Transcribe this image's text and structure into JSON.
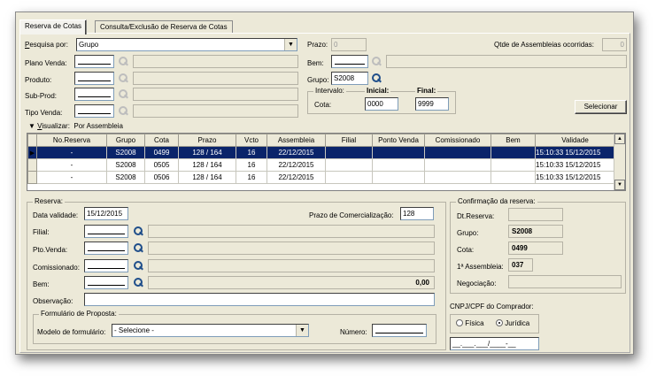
{
  "tabs": [
    "Reserva de Cotas",
    "Consulta/Exclusão de Reserva de Cotas"
  ],
  "pesquisa": {
    "label": "Pesquisa por:",
    "label_key": "P",
    "value": "Grupo"
  },
  "filters": [
    {
      "label": "Plano Venda:"
    },
    {
      "label": "Produto:"
    },
    {
      "label": "Sub-Prod:"
    },
    {
      "label": "Tipo Venda:"
    }
  ],
  "right": {
    "prazo_label": "Prazo:",
    "prazo_value": "0",
    "bem_label": "Bem:",
    "grupo_label": "Grupo:",
    "grupo_value": "S2008",
    "qtde_label": "Qtde de Assembleias ocorridas:",
    "qtde_value": "0",
    "intervalo_label": "Intervalo:",
    "inicial_label": "Inicial:",
    "final_label": "Final:",
    "cota_label": "Cota:",
    "inicial_value": "0000",
    "final_value": "9999",
    "selecionar_label": "Selecionar"
  },
  "visualizar": {
    "label": "Visualizar:",
    "label_key": "V",
    "value": "Por Assembleia"
  },
  "grid": {
    "columns": [
      "No.Reserva",
      "Grupo",
      "Cota",
      "Prazo",
      "Vcto",
      "Assembleia",
      "Filial",
      "Ponto Venda",
      "Comissionado",
      "Bem",
      "Validade"
    ],
    "rows": [
      [
        "-",
        "S2008",
        "0499",
        "128 / 164",
        "16",
        "22/12/2015",
        "",
        "",
        "",
        "",
        "15/12/2015 15:10:33"
      ],
      [
        "-",
        "S2008",
        "0505",
        "128 / 164",
        "16",
        "22/12/2015",
        "",
        "",
        "",
        "",
        "15/12/2015 15:10:33"
      ],
      [
        "-",
        "S2008",
        "0506",
        "128 / 164",
        "16",
        "22/12/2015",
        "",
        "",
        "",
        "",
        "15/12/2015 15:10:33"
      ]
    ],
    "selected_row": 0
  },
  "reserva": {
    "group_label": "Reserva:",
    "data_validade_label": "Data validade:",
    "data_validade_value": "15/12/2015",
    "prazo_com_label": "Prazo de Comercialização:",
    "prazo_com_value": "128",
    "filial_label": "Filial:",
    "pto_venda_label": "Pto.Venda:",
    "comissionado_label": "Comissionado:",
    "bem_label": "Bem:",
    "bem_valor": "0,00",
    "observacao_label": "Observação:"
  },
  "formulario": {
    "group_label": "Formulário de Proposta:",
    "modelo_label": "Modelo de formulário:",
    "modelo_value": "- Selecione -",
    "numero_label": "Número:"
  },
  "confirmacao": {
    "group_label": "Confirmação da reserva:",
    "dt_label": "Dt.Reserva:",
    "dt_value": "",
    "grupo_label": "Grupo:",
    "grupo_value": "S2008",
    "cota_label": "Cota:",
    "cota_value": "0499",
    "assembleia_label": "1ª Assembleia:",
    "assembleia_value": "037",
    "negociacao_label": "Negociação:"
  },
  "comprador": {
    "label": "CNPJ/CPF do Comprador:",
    "fisica_label": "Física",
    "juridica_label": "Jurídica",
    "selected": "Jurídica",
    "mask": "__.___.___/____-__"
  }
}
